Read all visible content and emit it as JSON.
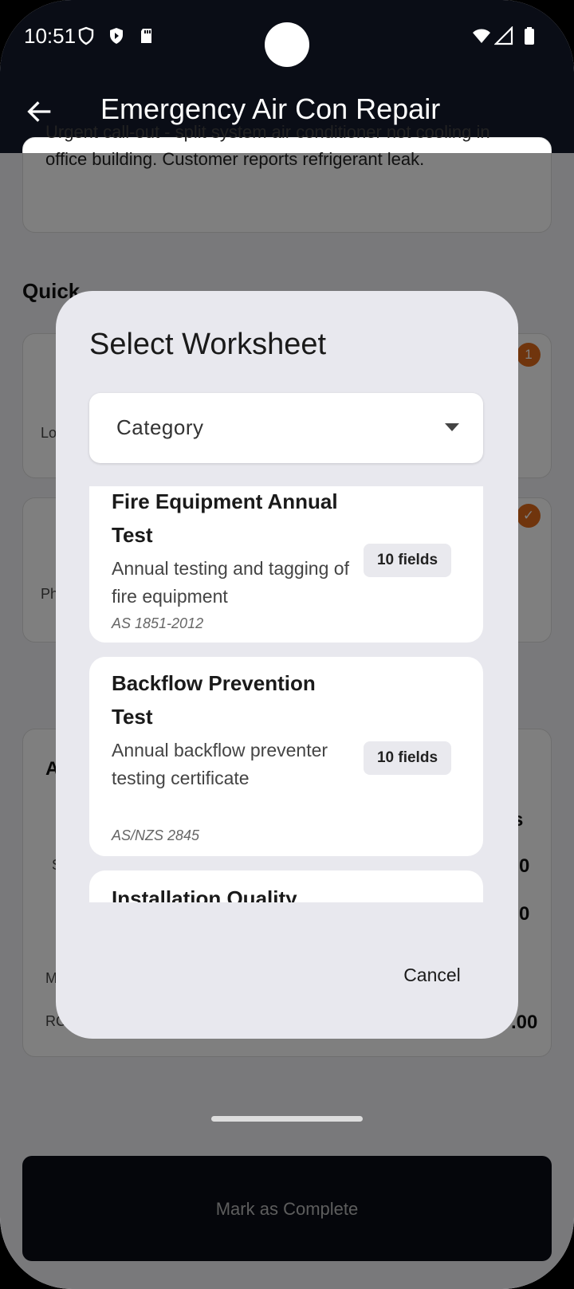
{
  "status_bar": {
    "time": "10:51"
  },
  "app_bar": {
    "title": "Emergency Air Con Repair"
  },
  "background": {
    "description": "Urgent call-out - split system air conditioner not cooling in office building. Customer reports refrigerant leak.",
    "quick_heading": "Quick",
    "badge_1": "1",
    "label_lo": "Lo",
    "label_ph": "Ph",
    "label_a": "A",
    "label_s": "S",
    "label_m": "M",
    "label_rc": "RC",
    "value_s_suffix": "s",
    "value_0a": "0",
    "value_0b": "0",
    "value_00": ".00",
    "mark_complete": "Mark as Complete"
  },
  "dialog": {
    "title": "Select Worksheet",
    "category_placeholder": "Category",
    "cancel_label": "Cancel",
    "items": [
      {
        "title": "Fire Equipment Annual Test",
        "description": "Annual testing and tagging of fire equipment",
        "standard": "AS 1851-2012",
        "fields": "10 fields"
      },
      {
        "title": "Backflow Prevention Test",
        "description": "Annual backflow preventer testing certificate",
        "standard": "AS/NZS 2845",
        "fields": "10 fields"
      },
      {
        "title": "Installation Quality",
        "description": "",
        "standard": "",
        "fields": ""
      }
    ]
  }
}
